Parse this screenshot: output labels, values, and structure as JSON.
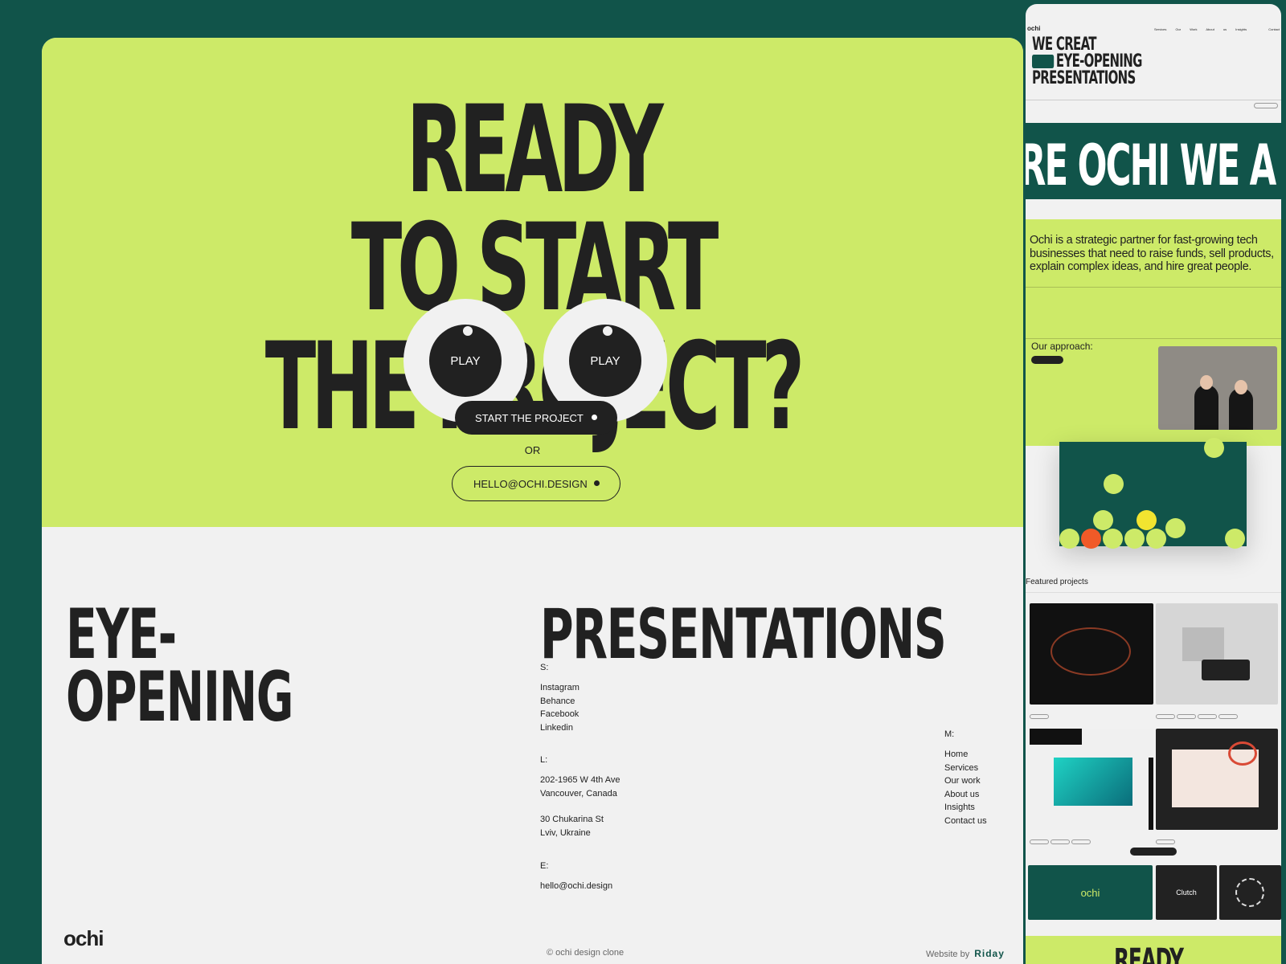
{
  "cta": {
    "line1": "READY",
    "line2": "TO START",
    "line3": "THE PROJECT?",
    "eye_label": "PLAY",
    "start_button": "START THE PROJECT",
    "or": "OR",
    "email_button": "HELLO@OCHI.DESIGN"
  },
  "footer": {
    "heading_left_1": "EYE-",
    "heading_left_2": "OPENING",
    "heading_right": "PRESENTATIONS",
    "socials_label": "S:",
    "socials": [
      "Instagram",
      "Behance",
      "Facebook",
      "Linkedin"
    ],
    "locations_label": "L:",
    "location1": [
      "202-1965 W 4th Ave",
      "Vancouver, Canada"
    ],
    "location2": [
      "30 Chukarina St",
      "Lviv, Ukraine"
    ],
    "email_label": "E:",
    "email": "hello@ochi.design",
    "menu_label": "M:",
    "menu": [
      "Home",
      "Services",
      "Our work",
      "About us",
      "Insights",
      "Contact us"
    ],
    "logo": "ochi",
    "copyright": "© ochi design clone",
    "website_by": "Website by",
    "agency": "Riday"
  },
  "preview": {
    "logo": "ochi",
    "nav_links": "Services Our Work About us Insights",
    "contact": "Contact",
    "hero_1": "WE CREAT",
    "hero_2": "EYE-OPENING",
    "hero_3": "PRESENTATIONS",
    "marquee": "RE OCHI WE A",
    "about": "Ochi is a strategic partner for fast-growing tech businesses that need to raise funds, sell products, explain complex ideas, and hire great people.",
    "approach": "Our approach:",
    "featured": "Featured projects",
    "card_ochi": "ochi",
    "card_clutch": "Clutch",
    "ready": "READY"
  },
  "colors": {
    "background": "#11544a",
    "accent": "#cdea68",
    "dark": "#212121",
    "light": "#f1f1f1"
  }
}
